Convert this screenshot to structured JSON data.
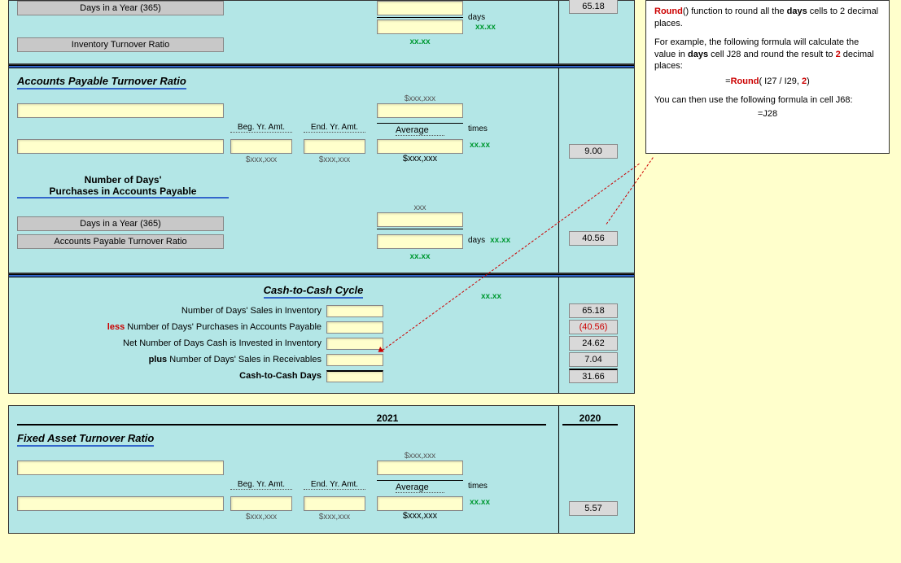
{
  "days_unit": "days",
  "times_unit": "times",
  "xx_placeholder": "xx.xx",
  "xxx_placeholder": "xxx",
  "money_ph": "$xxx,xxx",
  "section1": {
    "days_label": "Days in a Year (365)",
    "ratio_label": "Inventory Turnover Ratio",
    "result": "65.18"
  },
  "section2": {
    "title": "Accounts Payable Turnover Ratio",
    "beg": "Beg. Yr. Amt.",
    "end": "End. Yr. Amt.",
    "avg": "Average",
    "result": "9.00"
  },
  "section3": {
    "title1": "Number of Days'",
    "title2": "Purchases in Accounts Payable",
    "days_label": "Days in a Year (365)",
    "ratio_label": "Accounts Payable Turnover Ratio",
    "result": "40.56"
  },
  "section4": {
    "title": "Cash-to-Cash Cycle",
    "rows": [
      {
        "label_pre": "",
        "label": "Number of Days' Sales in Inventory",
        "value": "65.18",
        "red": false
      },
      {
        "label_pre": "less",
        "label": "Number of Days' Purchases in Accounts Payable",
        "value": "(40.56)",
        "red": true
      },
      {
        "label_pre": "",
        "label": "Net Number of Days Cash is Invested in Inventory",
        "value": "24.62",
        "red": false
      },
      {
        "label_pre": "plus",
        "label": "Number of Days' Sales in Receivables",
        "value": "7.04",
        "red": false
      },
      {
        "label_pre": "",
        "label": "Cash-to-Cash Days",
        "value": "31.66",
        "red": false,
        "bold": true
      }
    ]
  },
  "section5": {
    "title": "Fixed Asset Turnover Ratio",
    "year1": "2021",
    "year2": "2020",
    "beg": "Beg. Yr. Amt.",
    "end": "End. Yr. Amt.",
    "avg": "Average",
    "result": "5.57"
  },
  "help": {
    "l1a": "Round",
    "l1b": "() function to round all the ",
    "l1c": "days",
    "l1d": " cells to 2 decimal places.",
    "l2": "For example, the following formula will calculate the value in ",
    "l2b": "days",
    "l2c": " cell J28 and round the result to ",
    "l2d": "2",
    "l2e": " decimal places:",
    "formula_a": "=",
    "formula_b": "Round",
    "formula_c": "( I27 / I29, ",
    "formula_d": "2",
    "formula_e": ")",
    "l3": "You can then use the following formula in cell J68:",
    "formula2": "=J28"
  }
}
